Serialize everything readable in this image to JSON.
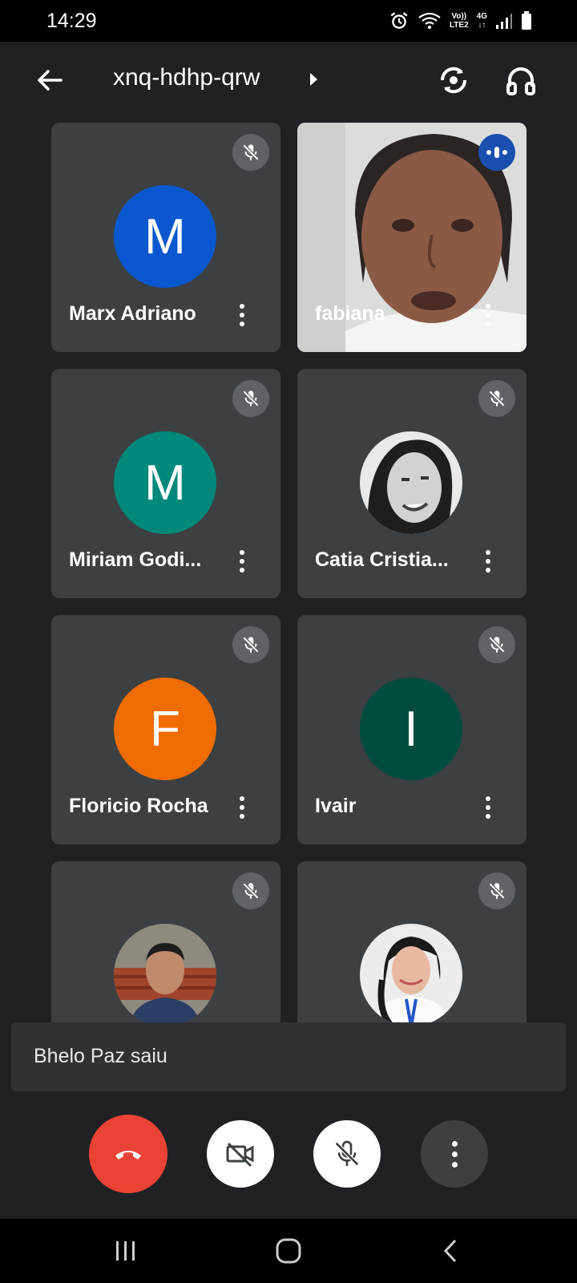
{
  "status_bar": {
    "time": "14:29",
    "network_label_1": "Vo))",
    "network_label_2": "LTE2",
    "network_type": "4G",
    "icons": [
      "alarm-icon",
      "wifi-icon",
      "signal-icon",
      "battery-icon"
    ]
  },
  "header": {
    "meeting_code": "xnq-hdhp-qrw",
    "icons": [
      "back-arrow-icon",
      "caret-right-icon",
      "switch-camera-icon",
      "headphones-icon"
    ]
  },
  "participants": [
    {
      "name": "Marx Adriano",
      "initial": "M",
      "avatar_color": "#0b57d0",
      "muted": true
    },
    {
      "name": "fabiana",
      "video": true,
      "speaking": true
    },
    {
      "name": "Miriam Godi...",
      "initial": "M",
      "avatar_color": "#00897b",
      "muted": true
    },
    {
      "name": "Catia Cristia...",
      "photo": true,
      "muted": true
    },
    {
      "name": "Floricio Rocha",
      "initial": "F",
      "avatar_color": "#ef6c00",
      "muted": true
    },
    {
      "name": "Ivair",
      "initial": "I",
      "avatar_color": "#004d40",
      "muted": true
    },
    {
      "name": "",
      "photo": true,
      "muted": true
    },
    {
      "name": "",
      "photo": true,
      "muted": true
    }
  ],
  "toast": {
    "message": "Bhelo Paz saiu"
  },
  "controls": {
    "end_call_color": "#ea4335",
    "icons": [
      "end-call-icon",
      "camera-off-icon",
      "mic-off-icon",
      "more-vert-icon"
    ]
  },
  "nav": {
    "icons": [
      "recents-icon",
      "home-icon",
      "back-icon"
    ]
  }
}
